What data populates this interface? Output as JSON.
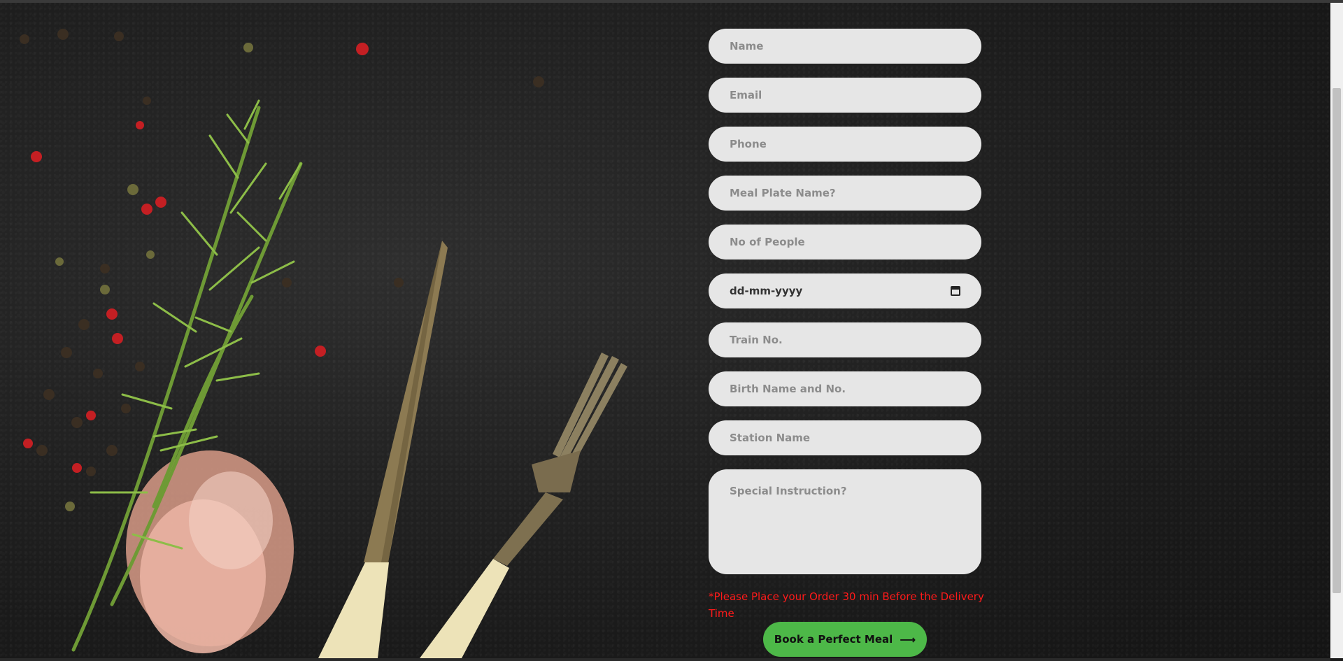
{
  "form": {
    "name_placeholder": "Name",
    "email_placeholder": "Email",
    "phone_placeholder": "Phone",
    "meal_placeholder": "Meal Plate Name?",
    "people_placeholder": "No of People",
    "date_value": "dd-mm-yyyy",
    "train_placeholder": "Train No.",
    "birth_placeholder": "Birth Name and No.",
    "station_placeholder": "Station Name",
    "instruction_placeholder": "Special Instruction?",
    "note": "*Please Place your Order 30 min Before the Delivery Time",
    "submit_label": "Book a Perfect Meal",
    "submit_arrow": "⟶"
  },
  "colors": {
    "accent_green": "#4db848",
    "note_red": "#ff1a1a",
    "field_bg": "#e6e6e6"
  },
  "icons": {
    "calendar": "calendar-icon",
    "arrow": "arrow-right-icon"
  }
}
